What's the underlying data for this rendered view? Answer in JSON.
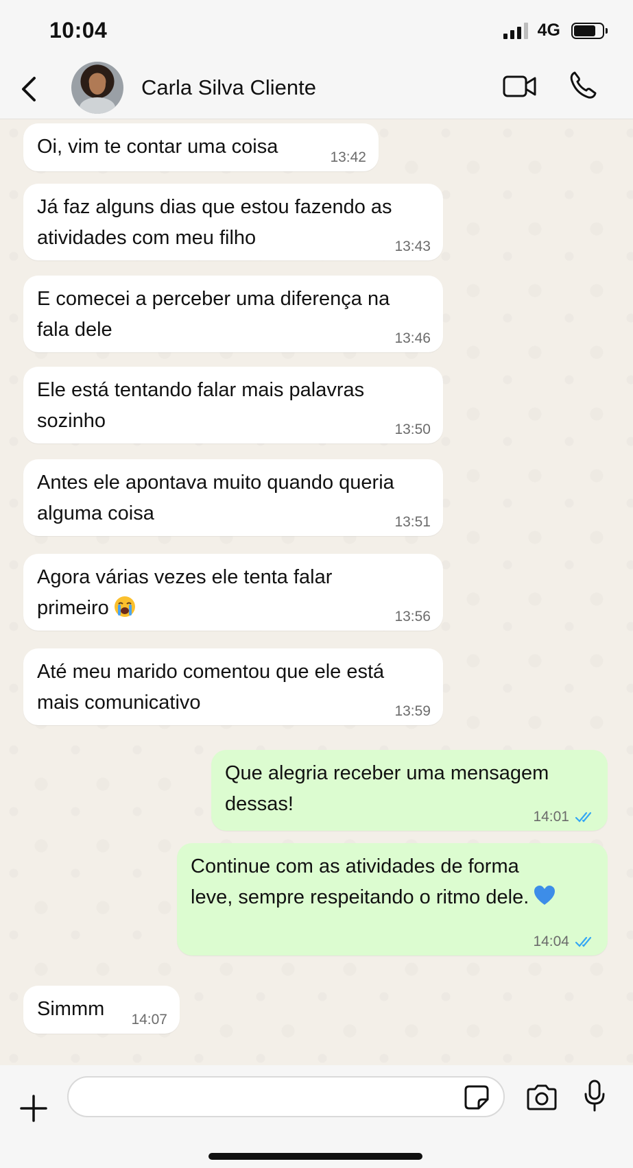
{
  "status": {
    "time": "10:04",
    "network": "4G"
  },
  "header": {
    "contact_name": "Carla Silva Cliente"
  },
  "messages": [
    {
      "text": "Oi, vim te contar uma coisa",
      "time": "13:42"
    },
    {
      "text": "Já faz alguns dias que estou fazendo as\natividades com meu filho",
      "time": "13:43"
    },
    {
      "text": "E comecei a perceber uma diferença na\nfala dele",
      "time": "13:46"
    },
    {
      "text": "Ele está tentando falar mais palavras\nsozinho",
      "time": "13:50"
    },
    {
      "text": "Antes ele apontava muito quando queria\nalguma coisa",
      "time": "13:51"
    },
    {
      "text": "Agora várias vezes ele tenta falar\nprimeiro",
      "time": "13:56",
      "emoji": "crying-face"
    },
    {
      "text": "Até meu marido comentou que ele está\nmais comunicativo",
      "time": "13:59"
    },
    {
      "text": "Que alegria receber uma mensagem\ndessas!",
      "time": "14:01",
      "outgoing": true,
      "read": true
    },
    {
      "text": "Continue com as atividades de forma\nleve, sempre respeitando o ritmo dele.",
      "time": "14:04",
      "outgoing": true,
      "read": true,
      "emoji": "blue-heart"
    },
    {
      "text": "Simmm",
      "time": "14:07"
    }
  ],
  "composer": {
    "placeholder": ""
  },
  "colors": {
    "outgoing_bubble": "#dcfcd0",
    "incoming_bubble": "#ffffff",
    "read_ticks": "#34a6f4"
  }
}
